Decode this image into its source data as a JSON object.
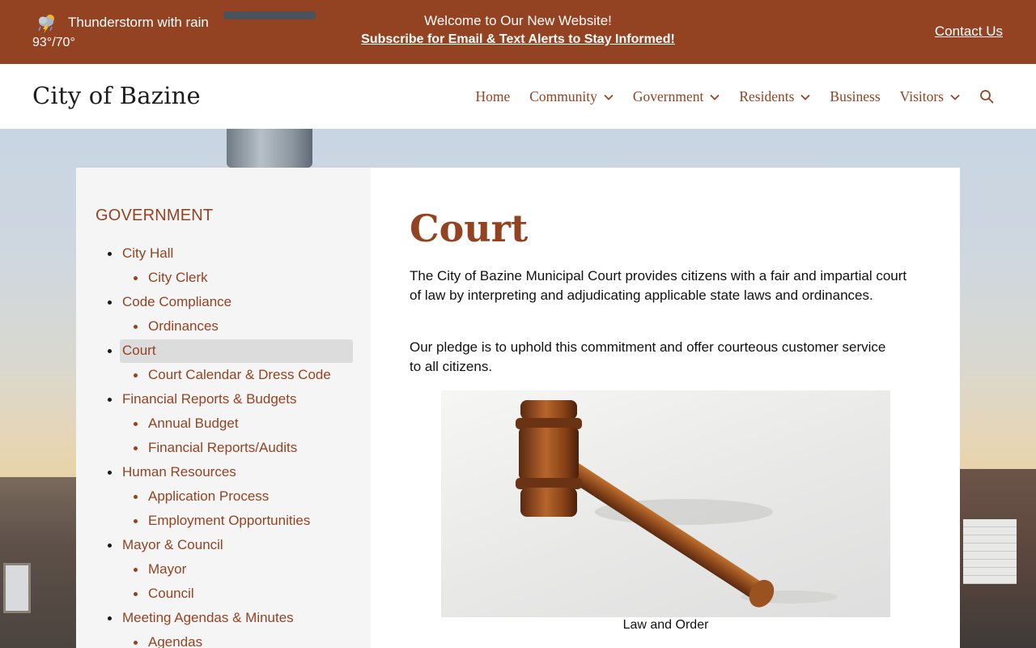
{
  "topbar": {
    "weather_condition": "Thunderstorm with rain",
    "weather_temps": "93°/70°",
    "weather_icon": "thunderstorm-icon",
    "announcement": "Welcome to Our New Website!",
    "subscribe_link": "Subscribe for Email & Text Alerts to Stay Informed!",
    "contact_link": "Contact Us"
  },
  "header": {
    "site_title": "City of Bazine",
    "nav": [
      {
        "label": "Home",
        "has_dropdown": false
      },
      {
        "label": "Community",
        "has_dropdown": true
      },
      {
        "label": "Government",
        "has_dropdown": true
      },
      {
        "label": "Residents",
        "has_dropdown": true
      },
      {
        "label": "Business",
        "has_dropdown": false
      },
      {
        "label": "Visitors",
        "has_dropdown": true
      }
    ],
    "search_icon": "search-icon"
  },
  "sidebar": {
    "heading": "GOVERNMENT",
    "items": [
      {
        "label": "City Hall",
        "level": 1
      },
      {
        "label": "City Clerk",
        "level": 2
      },
      {
        "label": "Code Compliance",
        "level": 1
      },
      {
        "label": "Ordinances",
        "level": 2
      },
      {
        "label": "Court",
        "level": 1,
        "active": true
      },
      {
        "label": "Court Calendar & Dress Code",
        "level": 2
      },
      {
        "label": "Financial Reports & Budgets",
        "level": 1
      },
      {
        "label": "Annual Budget",
        "level": 2
      },
      {
        "label": "Financial Reports/Audits",
        "level": 2
      },
      {
        "label": "Human Resources",
        "level": 1
      },
      {
        "label": "Application Process",
        "level": 2
      },
      {
        "label": "Employment Opportunities",
        "level": 2
      },
      {
        "label": "Mayor & Council",
        "level": 1
      },
      {
        "label": "Mayor",
        "level": 2
      },
      {
        "label": "Council",
        "level": 2
      },
      {
        "label": "Meeting Agendas & Minutes",
        "level": 1
      },
      {
        "label": "Agendas",
        "level": 2
      }
    ]
  },
  "main": {
    "title": "Court",
    "paragraph1": "The City of Bazine Municipal Court provides citizens with a fair and impartial court of law by interpreting and adjudicating applicable state laws and ordinances.",
    "paragraph2": "Our pledge is to uphold this commitment and offer courteous customer service to all citizens.",
    "image_caption": "Law and Order"
  },
  "colors": {
    "brand": "#944322",
    "sidebar_bg": "#f5f5f5",
    "active_bg": "#dcdcdc"
  }
}
